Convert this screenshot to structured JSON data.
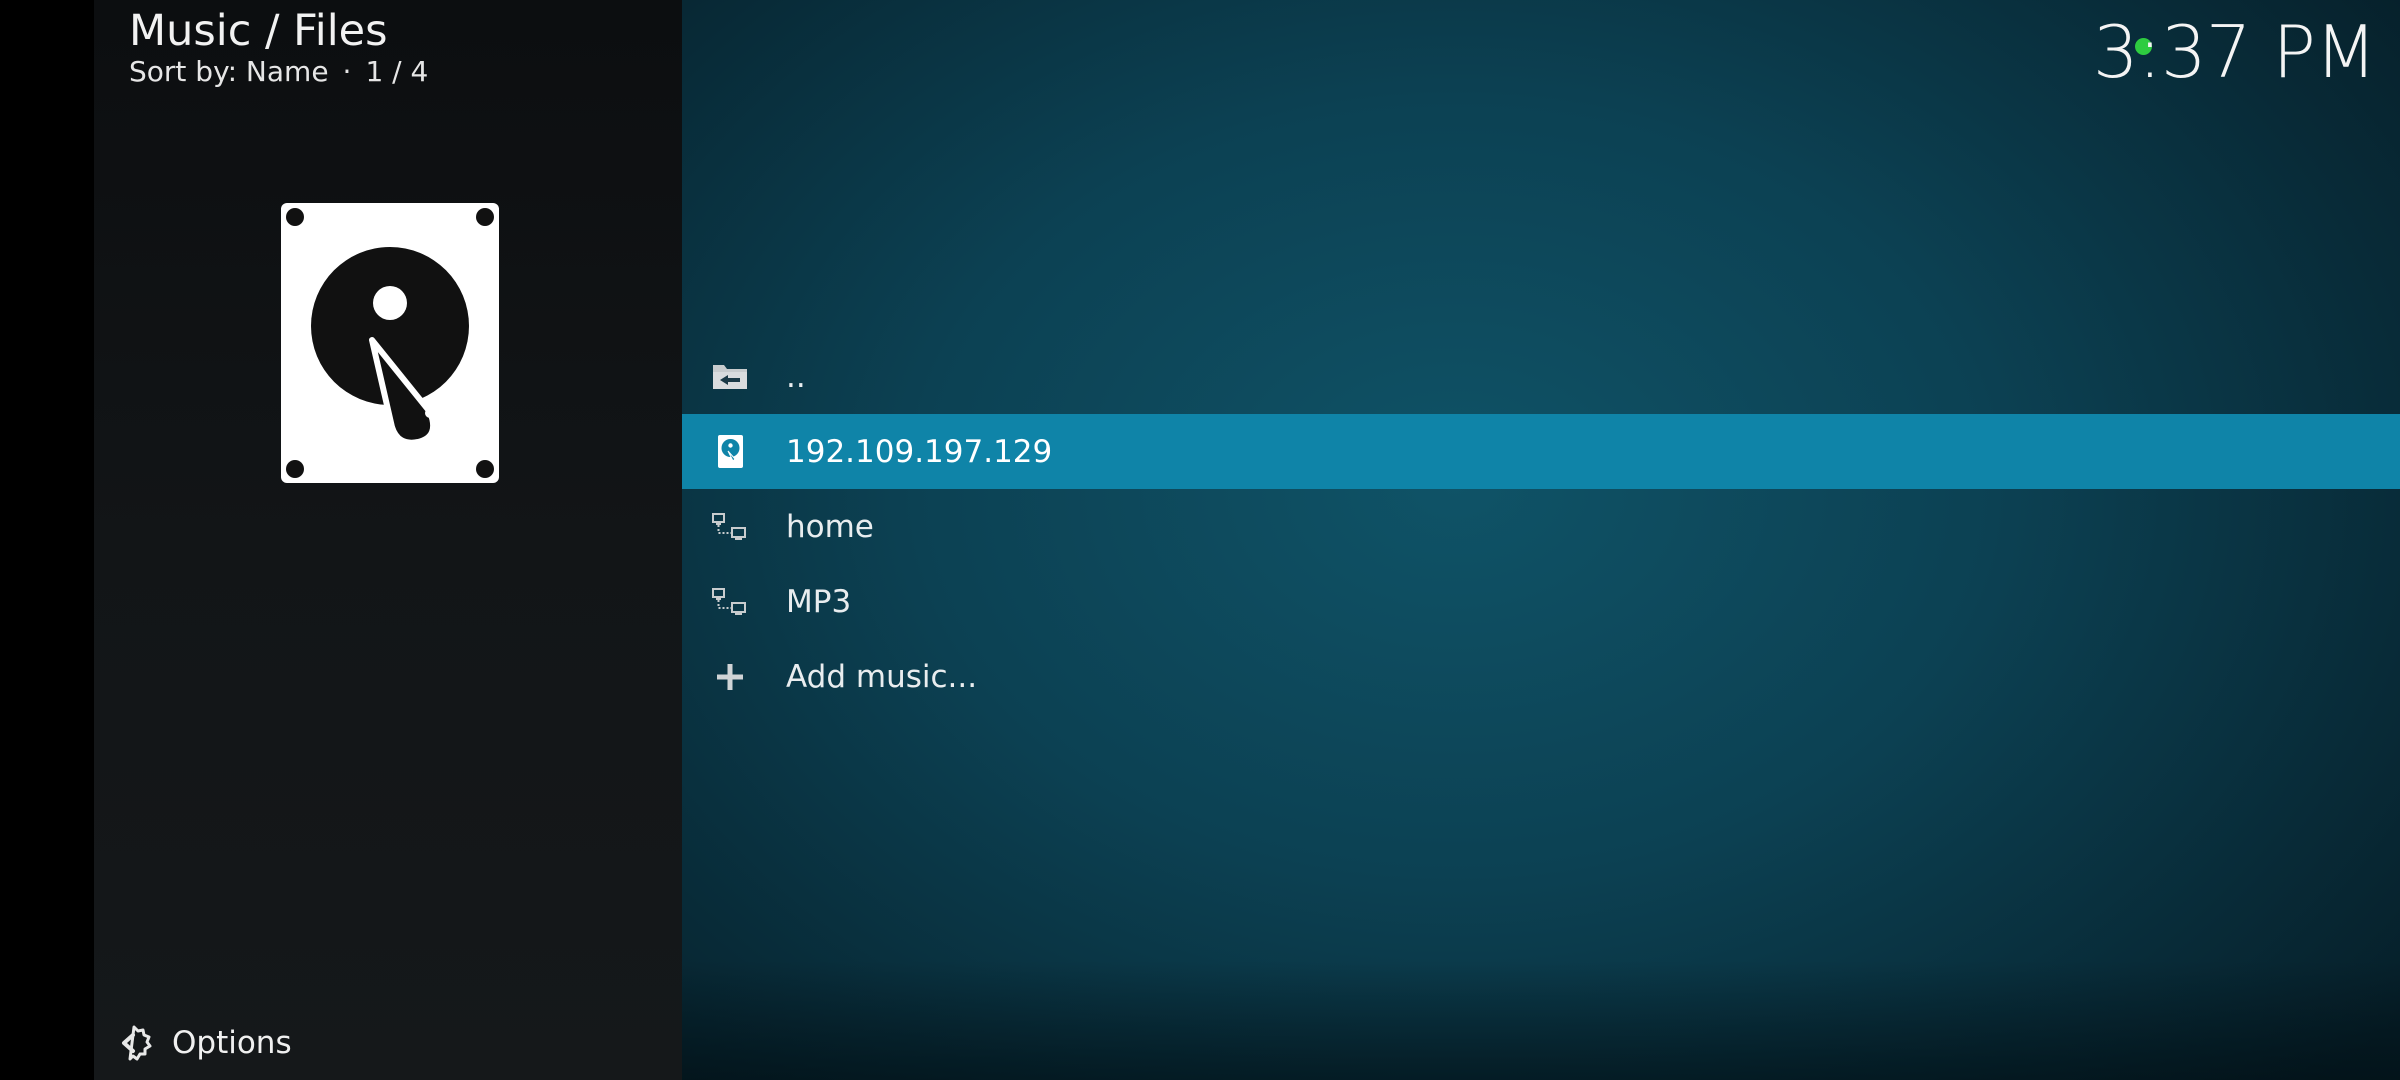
{
  "header": {
    "title": "Music / Files",
    "sort_label": "Sort by: Name",
    "separator": "·",
    "position": "1 / 4"
  },
  "clock": {
    "time": "3:37 PM"
  },
  "status": {
    "indicator_color": "#2ecc40"
  },
  "colors": {
    "selected_row": "#0f84a8",
    "panel_bg": "#121517",
    "main_bg": "#0c4153"
  },
  "list": {
    "items": [
      {
        "label": "..",
        "icon": "folder-back-icon",
        "selected": false
      },
      {
        "label": "192.109.197.129",
        "icon": "hard-disk-icon",
        "selected": true
      },
      {
        "label": "home",
        "icon": "network-share-icon",
        "selected": false
      },
      {
        "label": "MP3",
        "icon": "network-share-icon",
        "selected": false
      },
      {
        "label": "Add music...",
        "icon": "plus-icon",
        "selected": false
      }
    ]
  },
  "preview": {
    "icon": "hard-disk-icon"
  },
  "footer": {
    "options_label": "Options",
    "options_icon": "options-gear-icon"
  }
}
